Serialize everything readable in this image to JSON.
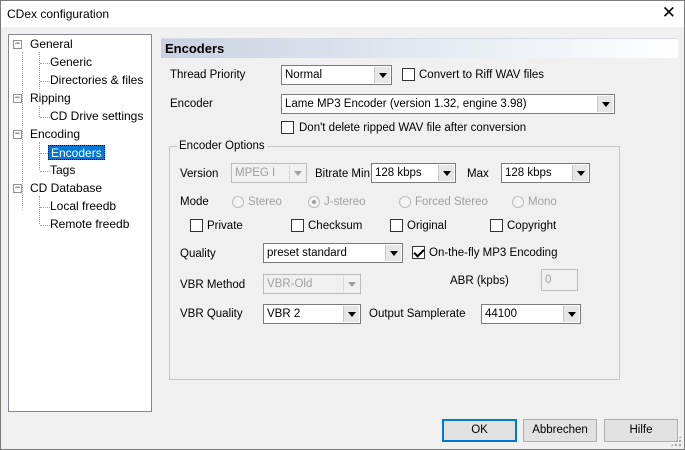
{
  "window": {
    "title": "CDex configuration",
    "close_glyph": "✕"
  },
  "tree": {
    "expander_glyph": "−",
    "items": [
      {
        "label": "General"
      },
      {
        "label": "Generic"
      },
      {
        "label": "Directories & files"
      },
      {
        "label": "Ripping"
      },
      {
        "label": "CD Drive settings"
      },
      {
        "label": "Encoding"
      },
      {
        "label": "Encoders",
        "selected": true
      },
      {
        "label": "Tags"
      },
      {
        "label": "CD Database"
      },
      {
        "label": "Local freedb"
      },
      {
        "label": "Remote freedb"
      }
    ]
  },
  "panel": {
    "header": "Encoders",
    "thread_priority_label": "Thread Priority",
    "thread_priority_value": "Normal",
    "convert_riff_label": "Convert to Riff WAV files",
    "encoder_label": "Encoder",
    "encoder_value": "Lame MP3 Encoder (version 1.32, engine 3.98)",
    "dont_delete_label": "Don't delete ripped WAV file after conversion",
    "options": {
      "title": "Encoder Options",
      "version_label": "Version",
      "version_value": "MPEG I",
      "bitrate_min_label": "Bitrate Min",
      "bitrate_min_value": "128 kbps",
      "max_label": "Max",
      "max_value": "128 kbps",
      "mode_label": "Mode",
      "mode_stereo": "Stereo",
      "mode_jstereo": "J-stereo",
      "mode_forced": "Forced Stereo",
      "mode_mono": "Mono",
      "private_label": "Private",
      "checksum_label": "Checksum",
      "original_label": "Original",
      "copyright_label": "Copyright",
      "quality_label": "Quality",
      "quality_value": "preset standard",
      "onthefly_label": "On-the-fly MP3 Encoding",
      "abr_label": "ABR (kpbs)",
      "abr_value": "0",
      "vbr_method_label": "VBR Method",
      "vbr_method_value": "VBR-Old",
      "vbr_quality_label": "VBR Quality",
      "vbr_quality_value": "VBR 2",
      "output_samplerate_label": "Output Samplerate",
      "output_samplerate_value": "44100"
    }
  },
  "buttons": {
    "ok": "OK",
    "cancel": "Abbrechen",
    "help": "Hilfe"
  }
}
